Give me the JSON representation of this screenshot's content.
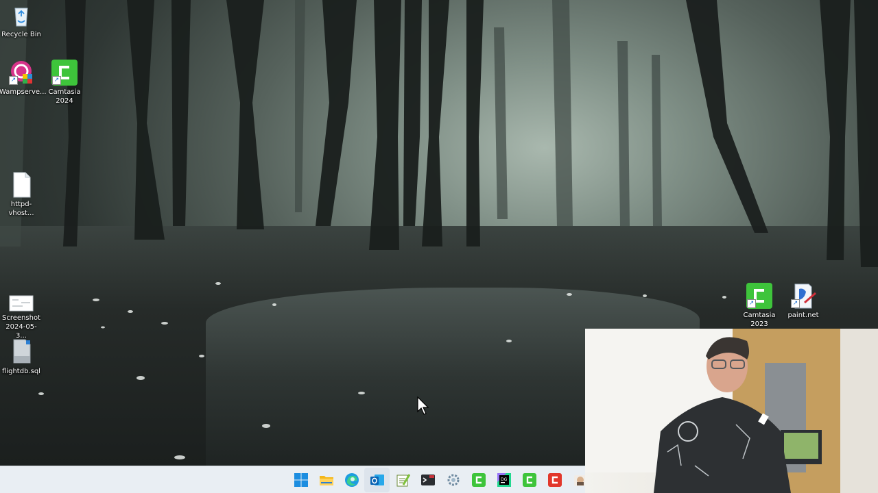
{
  "desktop": {
    "icons_left": [
      {
        "label": "Recycle Bin",
        "icon": "recycle-bin-icon"
      },
      {
        "label": "Wampserve...",
        "icon": "wampserver-icon"
      },
      {
        "label": "Camtasia 2024",
        "icon": "camtasia-icon"
      },
      {
        "label": "httpd-vhost...",
        "icon": "file-icon"
      },
      {
        "label": "Screenshot 2024-05-3...",
        "icon": "screenshot-icon"
      },
      {
        "label": "flightdb.sql",
        "icon": "sql-file-icon"
      }
    ],
    "icons_right": [
      {
        "label": "Camtasia 2023",
        "icon": "camtasia-icon"
      },
      {
        "label": "paint.net",
        "icon": "paintnet-icon"
      }
    ]
  },
  "taskbar": {
    "apps": [
      {
        "name": "Start",
        "icon": "windows-start-icon"
      },
      {
        "name": "File Explorer",
        "icon": "folder-icon"
      },
      {
        "name": "Microsoft Edge",
        "icon": "edge-icon"
      },
      {
        "name": "Outlook",
        "icon": "outlook-icon"
      },
      {
        "name": "Notepad++",
        "icon": "notepadpp-icon"
      },
      {
        "name": "Terminal",
        "icon": "terminal-icon"
      },
      {
        "name": "Settings",
        "icon": "settings-gear-icon"
      },
      {
        "name": "Camtasia 2024",
        "icon": "camtasia-icon"
      },
      {
        "name": "DataGrip",
        "icon": "datagrip-icon"
      },
      {
        "name": "Camtasia 2023",
        "icon": "camtasia-icon"
      },
      {
        "name": "Camtasia Recorder",
        "icon": "camtasia-recorder-icon"
      },
      {
        "name": "Store",
        "icon": "store-icon"
      }
    ]
  },
  "colors": {
    "camtasia_green": "#3ec43b",
    "wamp_pink": "#d6348a",
    "taskbar_bg": "#e9eef3"
  },
  "webcam": {
    "present": true
  }
}
